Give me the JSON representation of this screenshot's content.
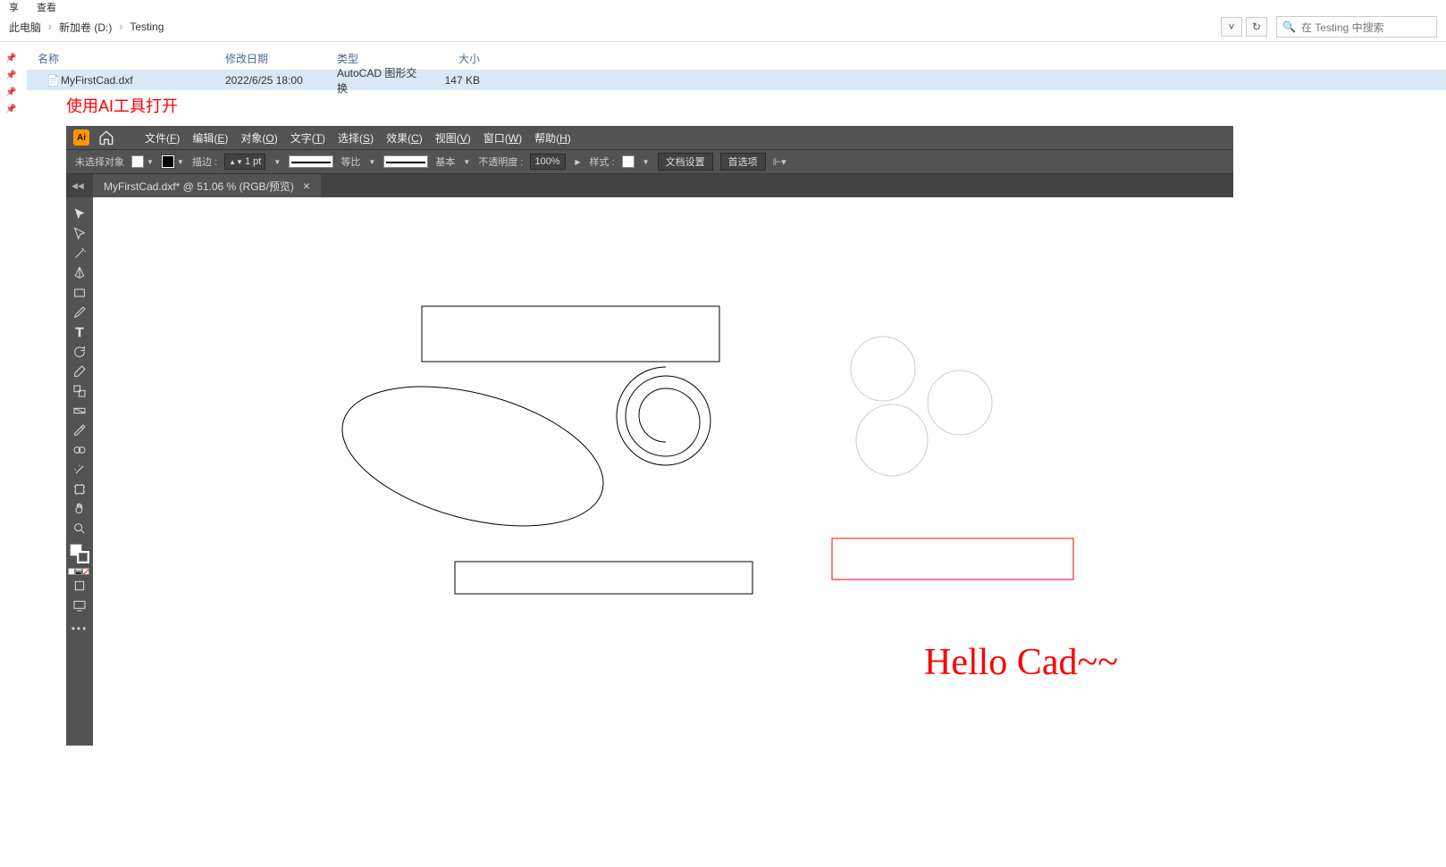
{
  "explorer": {
    "top_tabs": [
      "享",
      "查看"
    ],
    "breadcrumb": [
      "此电脑",
      "新加卷 (D:)",
      "Testing"
    ],
    "search_placeholder": "在 Testing 中搜索",
    "columns": {
      "name": "名称",
      "date": "修改日期",
      "type": "类型",
      "size": "大小"
    },
    "file": {
      "name": "MyFirstCad.dxf",
      "date": "2022/6/25 18:00",
      "type": "AutoCAD 图形交换",
      "size": "147 KB"
    }
  },
  "annotation": "使用AI工具打开",
  "ai": {
    "logo": "Ai",
    "menus": [
      {
        "label": "文件",
        "key": "F"
      },
      {
        "label": "编辑",
        "key": "E"
      },
      {
        "label": "对象",
        "key": "O"
      },
      {
        "label": "文字",
        "key": "T"
      },
      {
        "label": "选择",
        "key": "S"
      },
      {
        "label": "效果",
        "key": "C"
      },
      {
        "label": "视图",
        "key": "V"
      },
      {
        "label": "窗口",
        "key": "W"
      },
      {
        "label": "帮助",
        "key": "H"
      }
    ],
    "control": {
      "no_selection": "未选择对象",
      "stroke_label": "描边 :",
      "stroke_weight": "1 pt",
      "uniform": "等比",
      "basic": "基本",
      "opacity_label": "不透明度 :",
      "opacity_value": "100%",
      "style_label": "样式 :",
      "doc_setup": "文档设置",
      "preferences": "首选项"
    },
    "tab": {
      "title": "MyFirstCad.dxf* @ 51.06 % (RGB/预览)"
    },
    "canvas_text": "Hello Cad~~"
  }
}
